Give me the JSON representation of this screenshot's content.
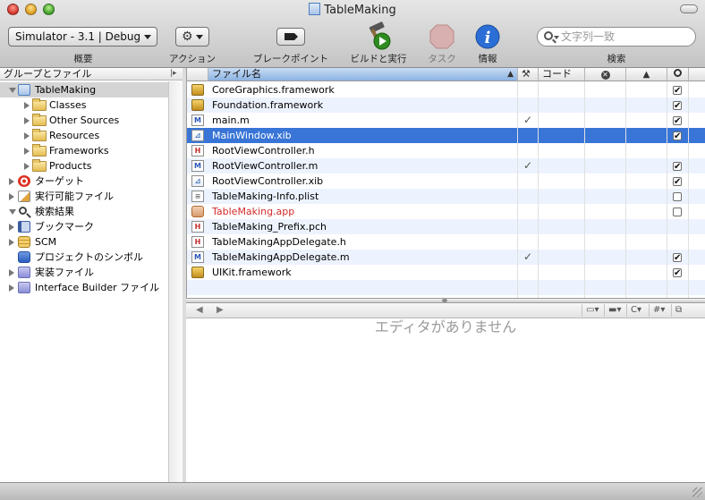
{
  "window": {
    "title": "TableMaking"
  },
  "toolbar": {
    "overview_popup": "Simulator - 3.1 | Debug",
    "overview_label": "概要",
    "action_label": "アクション",
    "breakpoints_label": "ブレークポイント",
    "build_run_label": "ビルドと実行",
    "tasks_label": "タスク",
    "info_label": "情報",
    "search_placeholder": "文字列一致",
    "search_label": "検索"
  },
  "sidebar": {
    "header": "グループとファイル",
    "items": [
      {
        "label": "TableMaking",
        "icon": "project-icon",
        "state": "open"
      },
      {
        "label": "Classes",
        "icon": "folder-icon",
        "state": "closed"
      },
      {
        "label": "Other Sources",
        "icon": "folder-icon",
        "state": "closed"
      },
      {
        "label": "Resources",
        "icon": "folder-icon",
        "state": "closed"
      },
      {
        "label": "Frameworks",
        "icon": "folder-icon",
        "state": "closed"
      },
      {
        "label": "Products",
        "icon": "folder-icon",
        "state": "closed"
      },
      {
        "label": "ターゲット",
        "icon": "target-icon",
        "state": "closed"
      },
      {
        "label": "実行可能ファイル",
        "icon": "executable-icon",
        "state": "closed"
      },
      {
        "label": "検索結果",
        "icon": "magnifier-icon",
        "state": "open"
      },
      {
        "label": "ブックマーク",
        "icon": "bookmark-icon",
        "state": "closed"
      },
      {
        "label": "SCM",
        "icon": "scm-icon",
        "state": "closed"
      },
      {
        "label": "プロジェクトのシンボル",
        "icon": "symbols-icon",
        "state": "none"
      },
      {
        "label": "実装ファイル",
        "icon": "smart-group-icon",
        "state": "closed"
      },
      {
        "label": "Interface Builder ファイル",
        "icon": "smart-group-icon",
        "state": "closed"
      }
    ]
  },
  "table": {
    "columns": {
      "filename": "ファイル名",
      "code": "コード"
    },
    "rows": [
      {
        "name": "CoreGraphics.framework",
        "icon": "framework",
        "build": false,
        "target": true
      },
      {
        "name": "Foundation.framework",
        "icon": "framework",
        "build": false,
        "target": true
      },
      {
        "name": "main.m",
        "icon": "m",
        "build": true,
        "target": true
      },
      {
        "name": "MainWindow.xib",
        "icon": "xib",
        "build": false,
        "target": true,
        "selected": true
      },
      {
        "name": "RootViewController.h",
        "icon": "h",
        "build": false,
        "target": null
      },
      {
        "name": "RootViewController.m",
        "icon": "m",
        "build": true,
        "target": true
      },
      {
        "name": "RootViewController.xib",
        "icon": "xib",
        "build": false,
        "target": true
      },
      {
        "name": "TableMaking-Info.plist",
        "icon": "plist",
        "build": false,
        "target": false
      },
      {
        "name": "TableMaking.app",
        "icon": "app",
        "build": false,
        "target": false,
        "missing": true
      },
      {
        "name": "TableMaking_Prefix.pch",
        "icon": "h",
        "build": false,
        "target": null
      },
      {
        "name": "TableMakingAppDelegate.h",
        "icon": "h",
        "build": false,
        "target": null
      },
      {
        "name": "TableMakingAppDelegate.m",
        "icon": "m",
        "build": true,
        "target": true
      },
      {
        "name": "UIKit.framework",
        "icon": "framework",
        "build": false,
        "target": true
      }
    ]
  },
  "editor": {
    "empty_message": "エディタがありません",
    "language_menu": "C"
  },
  "colors": {
    "selection": "#3875d7",
    "missing_file": "#d42b2b",
    "alt_row": "#edf3fe"
  }
}
